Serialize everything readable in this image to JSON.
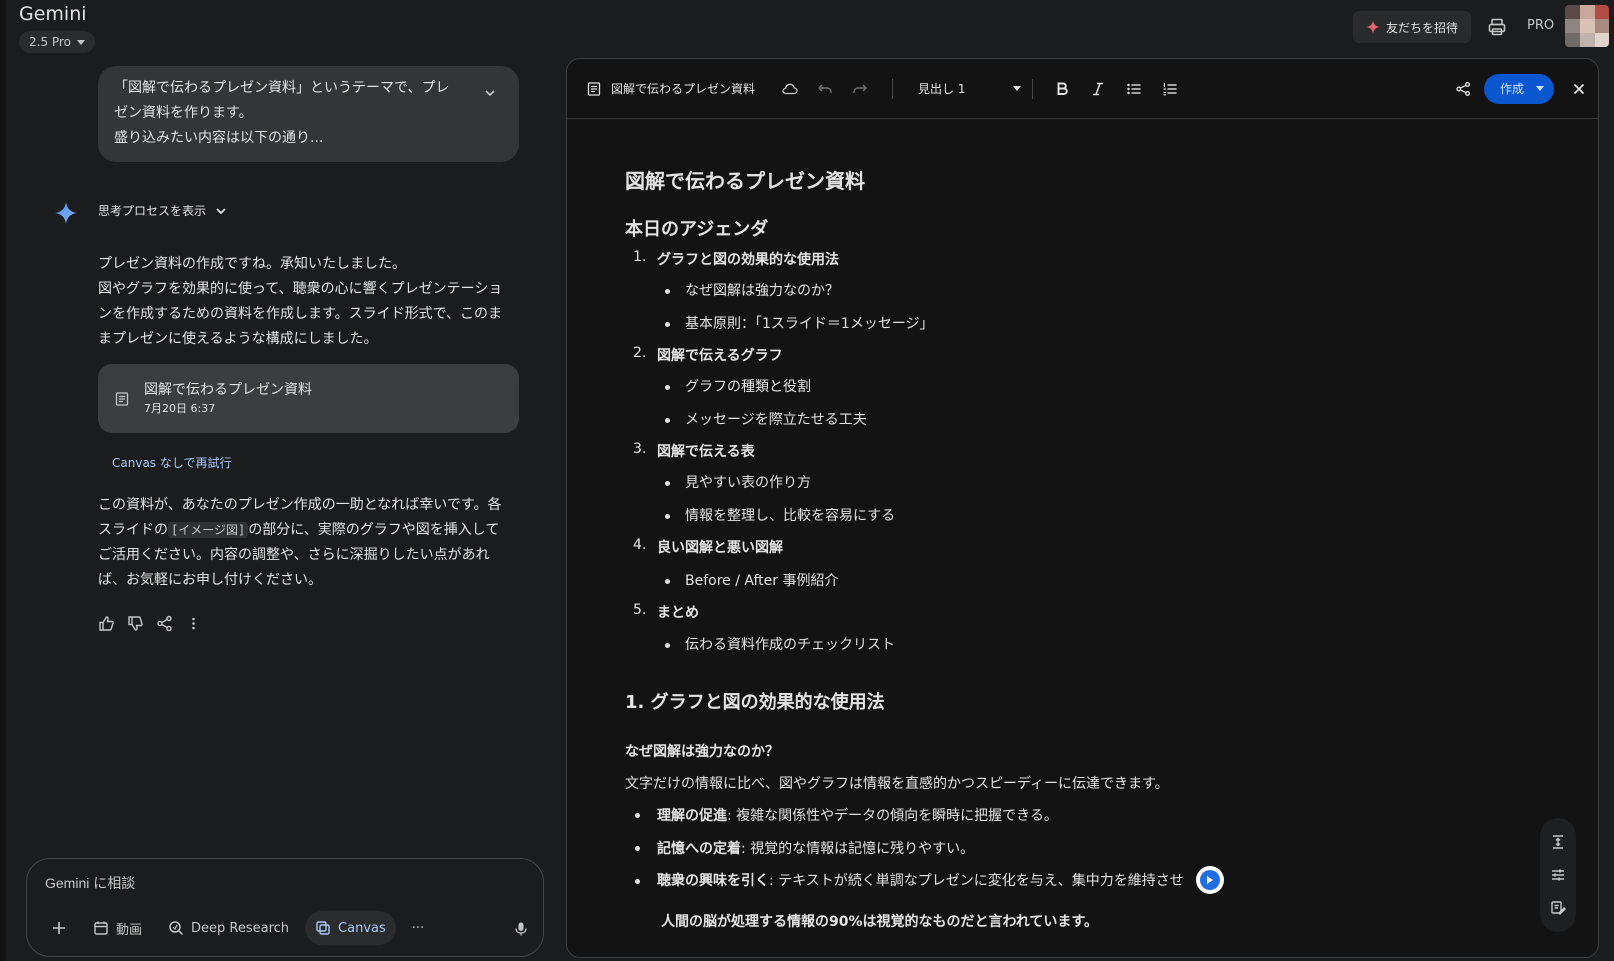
{
  "header": {
    "app_title": "Gemini",
    "model": "2.5 Pro",
    "invite_label": "友だちを招待",
    "pro_badge": "PRO"
  },
  "chat": {
    "user_prompt_lines": [
      "「図解で伝わるプレゼン資料」というテーマで、プレ",
      "ゼン資料を作ります。",
      "盛り込みたい内容は以下の通り..."
    ],
    "think_label": "思考プロセスを表示",
    "answer_lines": [
      "プレゼン資料の作成ですね。承知いたしました。",
      "図やグラフを効果的に使って、聴衆の心に響くプレゼンテーショ",
      "ンを作成するための資料を作成します。スライド形式で、このま",
      "まプレゼンに使えるような構成にしました。"
    ],
    "doc_card": {
      "title": "図解で伝わるプレゼン資料",
      "date": "7月20日 6:37"
    },
    "retry_canvas": "Canvas",
    "retry_rest": " なしで再試行",
    "closing": {
      "l1": "この資料が、あなたのプレゼン作成の一助となれば幸いです。各",
      "l2a": "スライドの",
      "l2chip": "[イメージ図]",
      "l2b": "の部分に、実際のグラフや図を挿入して",
      "l3": "ご活用ください。内容の調整や、さらに深掘りしたい点があれ",
      "l4": "ば、お気軽にお申し付けください。"
    }
  },
  "prompt": {
    "placeholder": "Gemini に相談",
    "tools": {
      "video": "動画",
      "research": "Deep Research",
      "canvas": "Canvas",
      "more": "···"
    }
  },
  "canvas": {
    "toolbar": {
      "doc_title": "図解で伝わるプレゼン資料",
      "heading_style": "見出し 1",
      "create_label": "作成"
    },
    "doc": {
      "h1": "図解で伝わるプレゼン資料",
      "agenda_title": "本日のアジェンダ",
      "agenda": [
        {
          "num": "1.",
          "title": "グラフと図の効果的な使用法",
          "bullets": [
            "なぜ図解は強力なのか？",
            "基本原則：「1スライド＝1メッセージ」"
          ]
        },
        {
          "num": "2.",
          "title": "図解で伝えるグラフ",
          "bullets": [
            "グラフの種類と役割",
            "メッセージを際立たせる工夫"
          ]
        },
        {
          "num": "3.",
          "title": "図解で伝える表",
          "bullets": [
            "見やすい表の作り方",
            "情報を整理し、比較を容易にする"
          ]
        },
        {
          "num": "4.",
          "title": "良い図解と悪い図解",
          "bullets": [
            "Before / After 事例紹介"
          ]
        },
        {
          "num": "5.",
          "title": "まとめ",
          "bullets": [
            "伝わる資料作成のチェックリスト"
          ]
        }
      ],
      "section1_title": "1. グラフと図の効果的な使用法",
      "why_title": "なぜ図解は強力なのか？",
      "why_para": "文字だけの情報に比べ、図やグラフは情報を直感的かつスピーディーに伝達できます。",
      "points": [
        {
          "strong": "理解の促進",
          "rest": ": 複雑な関係性やデータの傾向を瞬時に把握できる。"
        },
        {
          "strong": "記憶への定着",
          "rest": ": 視覚的な情報は記憶に残りやすい。"
        },
        {
          "strong": "聴衆の興味を引く",
          "rest": ": テキストが続く単調なプレゼンに変化を与え、集中力を維持させ"
        }
      ],
      "quote": "人間の脳が処理する情報の90%は視覚的なものだと言われています。"
    }
  },
  "colors": {
    "accent": "#0b57d0",
    "link": "#a8c7fa",
    "background": "#1b1c1d",
    "canvas_bg": "#131314"
  },
  "icons": [
    "sparkle-icon",
    "print-icon",
    "expand-icon",
    "gemini-star-icon",
    "chevron-down-icon",
    "document-icon",
    "thumb-up-icon",
    "thumb-down-icon",
    "share-icon",
    "more-vert-icon",
    "plus-icon",
    "calendar-icon",
    "research-icon",
    "canvas-icon",
    "mic-icon",
    "cloud-icon",
    "undo-icon",
    "redo-icon",
    "bold-icon",
    "italic-icon",
    "bulleted-list-icon",
    "numbered-list-icon",
    "close-icon",
    "vertical-align-icon",
    "tune-icon",
    "note-icon"
  ]
}
